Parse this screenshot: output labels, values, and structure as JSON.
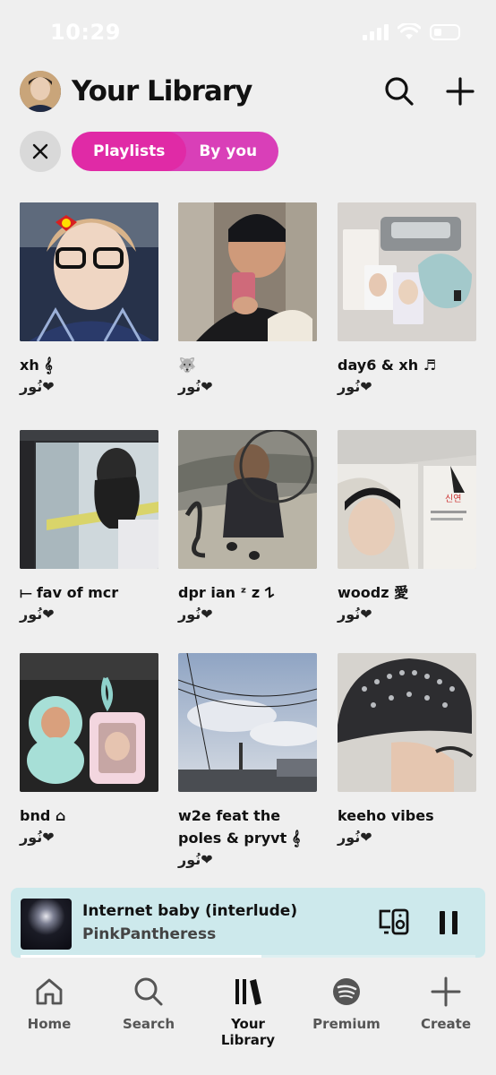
{
  "status_bar": {
    "time": "10:29"
  },
  "header": {
    "title": "Your Library"
  },
  "filters": {
    "primary": "Playlists",
    "secondary": "By you"
  },
  "playlists": [
    {
      "name": "xh 𝄞",
      "owner": "نُور❤"
    },
    {
      "name": "🐺",
      "owner": "نُور❤"
    },
    {
      "name": "day6 & xh ♬",
      "owner": "نُور❤"
    },
    {
      "name": "⟝ fav of mcr",
      "owner": "نُور❤"
    },
    {
      "name": "dpr ian ᶻ z 𐰁",
      "owner": "نُور❤"
    },
    {
      "name": "woodz 愛",
      "owner": "نُور❤"
    },
    {
      "name": "bnd ⌂",
      "owner": "نُور❤"
    },
    {
      "name": "w2e feat the poles & pryvt 𝄞",
      "owner": "نُور❤"
    },
    {
      "name": "keeho vibes",
      "owner": "نُور❤"
    }
  ],
  "now_playing": {
    "title": "Internet baby (interlude)",
    "artist": "PinkPantheress",
    "progress": 0.53
  },
  "nav": [
    {
      "label": "Home",
      "icon": "home-icon"
    },
    {
      "label": "Search",
      "icon": "search-icon"
    },
    {
      "label": "Your Library",
      "icon": "library-icon"
    },
    {
      "label": "Premium",
      "icon": "spotify-logo-icon"
    },
    {
      "label": "Create",
      "icon": "plus-icon"
    }
  ],
  "colors": {
    "accent": "#e02aa6",
    "nowplaying_bg": "#cde9ec",
    "background": "#efefef"
  }
}
